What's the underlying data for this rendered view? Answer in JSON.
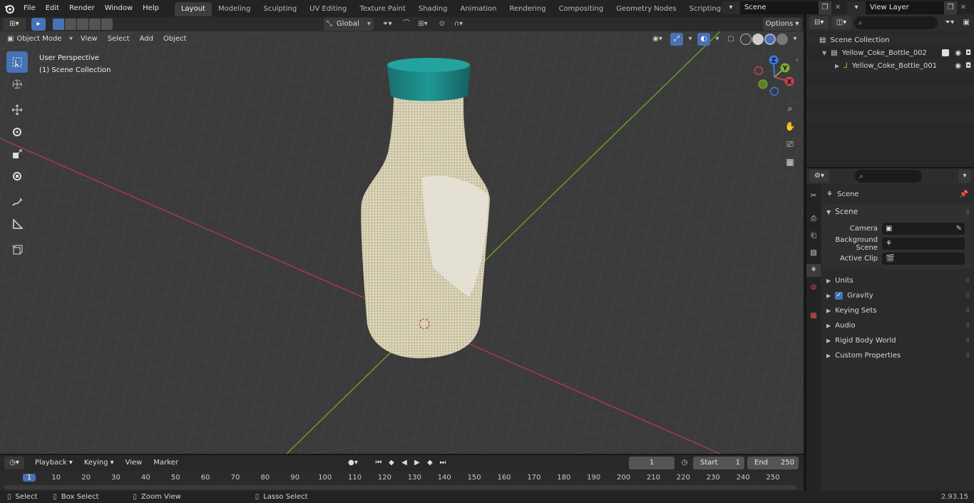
{
  "topbar": {
    "menus": [
      "File",
      "Edit",
      "Render",
      "Window",
      "Help"
    ],
    "workspaces": [
      "Layout",
      "Modeling",
      "Sculpting",
      "UV Editing",
      "Texture Paint",
      "Shading",
      "Animation",
      "Rendering",
      "Compositing",
      "Geometry Nodes",
      "Scripting"
    ],
    "active_workspace": "Layout",
    "scene": "Scene",
    "view_layer": "View Layer"
  },
  "viewport_header": {
    "mode": "Object Mode",
    "menus": [
      "View",
      "Select",
      "Add",
      "Object"
    ],
    "transform_orientation": "Global",
    "options_label": "Options"
  },
  "viewport": {
    "perspective_label": "User Perspective",
    "collection_label": "(1) Scene Collection",
    "gizmo_axes": {
      "x": "X",
      "y": "Y",
      "z": "Z"
    },
    "object": "Yellow_Coke_Bottle_001",
    "colors": {
      "bottle": "#d8d2b4",
      "cap": "#1f8f8c",
      "x_axis": "#a83a45",
      "y_axis": "#6a9a2a"
    }
  },
  "outliner": {
    "root": "Scene Collection",
    "items": [
      {
        "label": "Yellow_Coke_Bottle_002"
      },
      {
        "label": "Yellow_Coke_Bottle_001"
      }
    ]
  },
  "properties": {
    "context": "Scene",
    "panel_title": "Scene",
    "fields": [
      {
        "label": "Camera"
      },
      {
        "label": "Background Scene"
      },
      {
        "label": "Active Clip"
      }
    ],
    "sections": [
      "Units",
      "Gravity",
      "Keying Sets",
      "Audio",
      "Rigid Body World",
      "Custom Properties"
    ]
  },
  "timeline": {
    "menus": [
      "Playback",
      "Keying",
      "View",
      "Marker"
    ],
    "current_frame": "1",
    "start_label": "Start",
    "start": "1",
    "end_label": "End",
    "end": "250",
    "ruler": [
      "1",
      "10",
      "20",
      "30",
      "40",
      "50",
      "60",
      "70",
      "80",
      "90",
      "100",
      "110",
      "120",
      "130",
      "140",
      "150",
      "160",
      "170",
      "180",
      "190",
      "200",
      "210",
      "220",
      "230",
      "240",
      "250"
    ]
  },
  "statusbar": {
    "items": [
      "Select",
      "Box Select",
      "Zoom View",
      "Lasso Select"
    ],
    "version": "2.93.15"
  }
}
